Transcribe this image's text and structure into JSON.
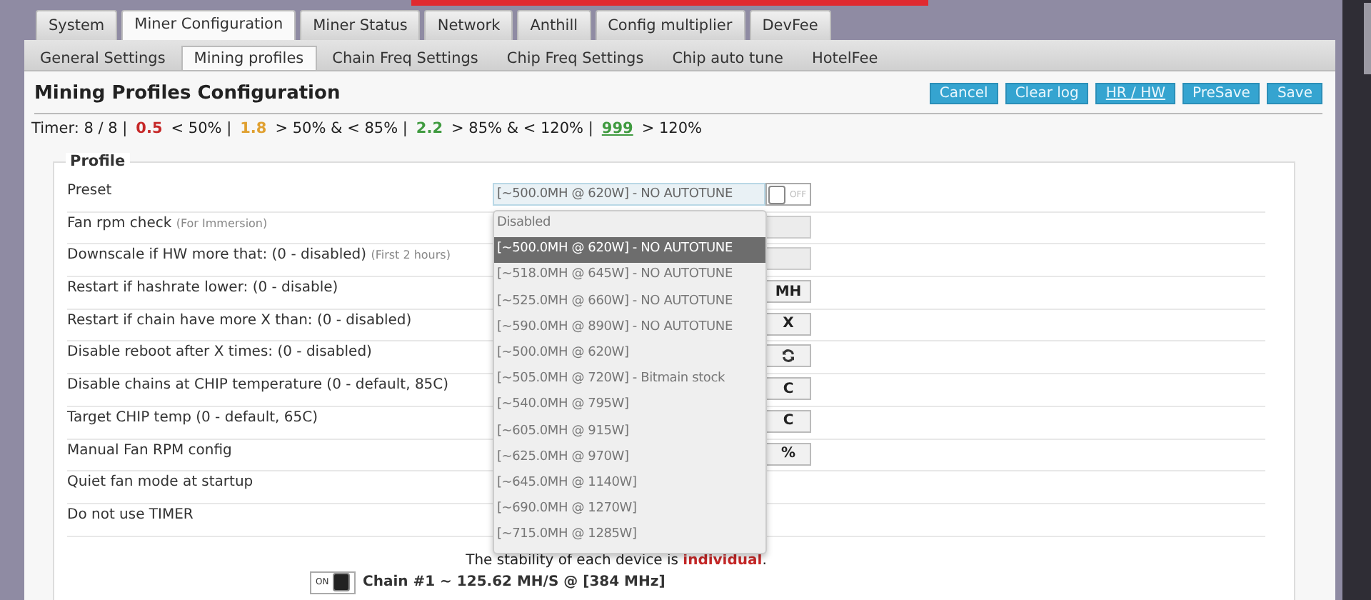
{
  "top_tabs": [
    {
      "label": "System",
      "selected": false
    },
    {
      "label": "Miner Configuration",
      "selected": true
    },
    {
      "label": "Miner Status",
      "selected": false
    },
    {
      "label": "Network",
      "selected": false
    },
    {
      "label": "Anthill",
      "selected": false
    },
    {
      "label": "Config multiplier",
      "selected": false
    },
    {
      "label": "DevFee",
      "selected": false
    }
  ],
  "sub_tabs": [
    {
      "label": "General Settings",
      "selected": false
    },
    {
      "label": "Mining profiles",
      "selected": true
    },
    {
      "label": "Chain Freq Settings",
      "selected": false
    },
    {
      "label": "Chip Freq Settings",
      "selected": false
    },
    {
      "label": "Chip auto tune",
      "selected": false
    },
    {
      "label": "HotelFee",
      "selected": false
    }
  ],
  "title": "Mining Profiles Configuration",
  "buttons": [
    {
      "label": "Cancel",
      "underline": false
    },
    {
      "label": "Clear log",
      "underline": false
    },
    {
      "label": "HR / HW",
      "underline": true
    },
    {
      "label": "PreSave",
      "underline": false
    },
    {
      "label": "Save",
      "underline": false
    }
  ],
  "timer": [
    {
      "kind": "text",
      "text": "Timer: 8 / 8 |"
    },
    {
      "kind": "value",
      "text": "0.5",
      "color": "#c62828"
    },
    {
      "kind": "text",
      "text": "< 50% |"
    },
    {
      "kind": "value",
      "text": "1.8",
      "color": "#e0a030"
    },
    {
      "kind": "text",
      "text": "> 50% & < 85% |"
    },
    {
      "kind": "value",
      "text": "2.2",
      "color": "#3f9a3f"
    },
    {
      "kind": "text",
      "text": "> 85% & < 120% |"
    },
    {
      "kind": "link",
      "text": "999",
      "color": "#3f9a3f"
    },
    {
      "kind": "text",
      "text": "> 120%"
    }
  ],
  "profile": {
    "legend": "Profile",
    "rows": [
      {
        "label": "Preset",
        "control": {
          "kind": "select",
          "value": "[~500.0MH @ 620W] - NO AUTOTUNE",
          "expanded": true,
          "options": [
            {
              "label": "Disabled",
              "selected": false
            },
            {
              "label": "[~500.0MH @ 620W] - NO AUTOTUNE",
              "selected": true
            },
            {
              "label": "[~518.0MH @ 645W] - NO AUTOTUNE",
              "selected": false
            },
            {
              "label": "[~525.0MH @ 660W] - NO AUTOTUNE",
              "selected": false
            },
            {
              "label": "[~590.0MH @ 890W] - NO AUTOTUNE",
              "selected": false
            },
            {
              "label": "[~500.0MH @ 620W]",
              "selected": false
            },
            {
              "label": "[~505.0MH @ 720W] - Bitmain stock",
              "selected": false
            },
            {
              "label": "[~540.0MH @ 795W]",
              "selected": false
            },
            {
              "label": "[~605.0MH @ 915W]",
              "selected": false
            },
            {
              "label": "[~625.0MH @ 970W]",
              "selected": false
            },
            {
              "label": "[~645.0MH @ 1140W]",
              "selected": false
            },
            {
              "label": "[~690.0MH @ 1270W]",
              "selected": false
            },
            {
              "label": "[~715.0MH @ 1285W]",
              "selected": false
            }
          ],
          "toggle": {
            "checked": false,
            "label": "OFF"
          }
        }
      },
      {
        "label": "Fan rpm check",
        "note": "(For Immersion)",
        "control": {
          "kind": "input"
        }
      },
      {
        "label": "Downscale if HW more that: (0 - disabled)",
        "note": "(First 2 hours)",
        "control": {
          "kind": "input"
        }
      },
      {
        "label": "Restart if hashrate lower: (0 - disable)",
        "control": {
          "kind": "unit",
          "text": "MH"
        }
      },
      {
        "label": "Restart if chain have more X than: (0 - disabled)",
        "control": {
          "kind": "unit",
          "text": "X"
        }
      },
      {
        "label": "Disable reboot after X times: (0 - disabled)",
        "control": {
          "kind": "icon"
        }
      },
      {
        "label": "Disable chains at CHIP temperature (0 - default, 85C)",
        "control": {
          "kind": "unit",
          "text": "C"
        }
      },
      {
        "label": "Target CHIP temp (0 - default, 65C)",
        "control": {
          "kind": "unit",
          "text": "C"
        }
      },
      {
        "label": "Manual Fan RPM config",
        "control": {
          "kind": "unit",
          "text": "%"
        }
      },
      {
        "label": "Quiet fan mode at startup"
      },
      {
        "label": "Do not use TIMER"
      }
    ],
    "notice": "The stability of each device is **individual**."
  },
  "chain": {
    "toggle": {
      "checked": true,
      "label": "ON"
    },
    "text": "Chain #1 ~ 125.62 MH/S @ [384 MHz]"
  }
}
